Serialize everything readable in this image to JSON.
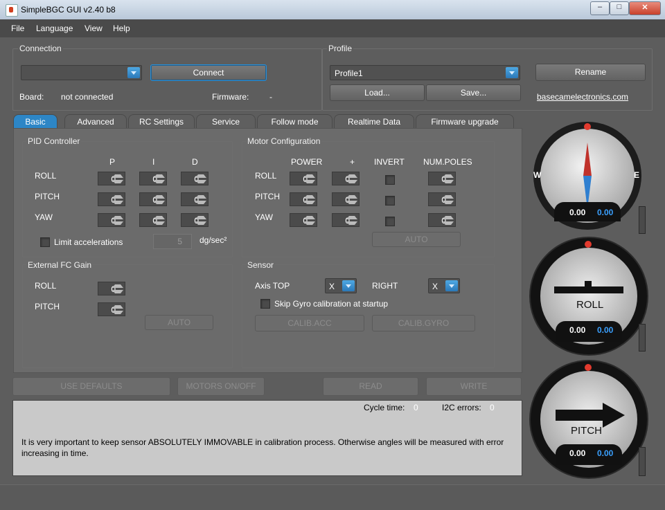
{
  "window": {
    "title": "SimpleBGC GUI v2.40 b8",
    "controls": {
      "minimize": "–",
      "maximize": "□",
      "close": "✕"
    }
  },
  "menu": [
    "File",
    "Language",
    "View",
    "Help"
  ],
  "connection": {
    "label": "Connection",
    "port_value": "",
    "connect_label": "Connect",
    "board_label": "Board:",
    "board_value": "not connected",
    "firmware_label": "Firmware:",
    "firmware_value": "-"
  },
  "profile": {
    "label": "Profile",
    "selected": "Profile1",
    "rename_label": "Rename",
    "load_label": "Load...",
    "save_label": "Save...",
    "link": "basecamelectronics.com"
  },
  "tabs": [
    "Basic",
    "Advanced",
    "RC Settings",
    "Service",
    "Follow mode",
    "Realtime Data",
    "Firmware upgrade"
  ],
  "pid": {
    "label": "PID Controller",
    "cols": [
      "P",
      "I",
      "D"
    ],
    "rows": [
      {
        "name": "ROLL",
        "values": [
          "0",
          "0",
          "0"
        ]
      },
      {
        "name": "PITCH",
        "values": [
          "0",
          "0",
          "0"
        ]
      },
      {
        "name": "YAW",
        "values": [
          "0",
          "0",
          "0"
        ]
      }
    ],
    "limit_label": "Limit accelerations",
    "limit_value": "5",
    "limit_unit": "dg/sec²"
  },
  "motor": {
    "label": "Motor Configuration",
    "cols": [
      "POWER",
      "+",
      "INVERT",
      "NUM.POLES"
    ],
    "rows": [
      {
        "name": "ROLL",
        "power": "0",
        "plus": "0",
        "poles": "0"
      },
      {
        "name": "PITCH",
        "power": "0",
        "plus": "0",
        "poles": "0"
      },
      {
        "name": "YAW",
        "power": "0",
        "plus": "0",
        "poles": "0"
      }
    ],
    "auto_label": "AUTO"
  },
  "extfc": {
    "label": "External FC Gain",
    "rows": [
      {
        "name": "ROLL",
        "value": "0"
      },
      {
        "name": "PITCH",
        "value": "0"
      }
    ],
    "auto_label": "AUTO"
  },
  "sensor": {
    "label": "Sensor",
    "axis_top_label": "Axis TOP",
    "axis_top_value": "X",
    "right_label": "RIGHT",
    "right_value": "X",
    "skip_label": "Skip Gyro calibration at startup",
    "calib_acc": "CALIB.ACC",
    "calib_gyro": "CALIB.GYRO"
  },
  "actions": {
    "use_defaults": "USE DEFAULTS",
    "motors": "MOTORS ON/OFF",
    "read": "READ",
    "write": "WRITE"
  },
  "status": {
    "cycle_label": "Cycle time:",
    "cycle_value": "0",
    "i2c_label": "I2C errors:",
    "i2c_value": "0",
    "message": "It is very important to keep sensor ABSOLUTELY IMMOVABLE in calibration process. Otherwise angles will be measured with error increasing in time."
  },
  "gauges": {
    "yaw": {
      "west": "W",
      "east": "E",
      "value": "0.00",
      "target": "0.00"
    },
    "roll": {
      "label": "ROLL",
      "value": "0.00",
      "target": "0.00"
    },
    "pitch": {
      "label": "PITCH",
      "value": "0.00",
      "target": "0.00"
    }
  },
  "colors": {
    "accent": "#2d86c6",
    "value_blue": "#3aa0ff",
    "background": "#5d5d5d"
  }
}
